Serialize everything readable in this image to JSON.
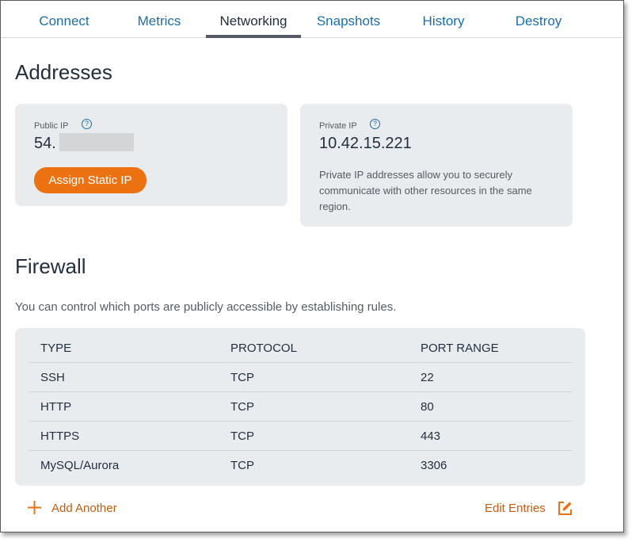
{
  "tabs": [
    {
      "label": "Connect"
    },
    {
      "label": "Metrics"
    },
    {
      "label": "Networking"
    },
    {
      "label": "Snapshots"
    },
    {
      "label": "History"
    },
    {
      "label": "Destroy"
    }
  ],
  "addresses": {
    "title": "Addresses",
    "public": {
      "label": "Public IP",
      "help": "?",
      "value_prefix": "54.",
      "assign_button": "Assign Static IP"
    },
    "private": {
      "label": "Private IP",
      "help": "?",
      "value": "10.42.15.221",
      "description_lines": [
        "Private IP addresses allow you to securely",
        "communicate with other resources in the same",
        "region."
      ]
    }
  },
  "firewall": {
    "title": "Firewall",
    "intro": "You can control which ports are publicly accessible by establishing rules.",
    "columns": [
      "TYPE",
      "PROTOCOL",
      "PORT RANGE"
    ],
    "rows": [
      [
        "SSH",
        "TCP",
        "22"
      ],
      [
        "HTTP",
        "TCP",
        "80"
      ],
      [
        "HTTPS",
        "TCP",
        "443"
      ],
      [
        "MySQL/Aurora",
        "TCP",
        "3306"
      ]
    ],
    "add_label": "Add Another",
    "edit_label": "Edit Entries"
  },
  "colors": {
    "accent_orange": "#ec7211",
    "link_blue": "#1a6ea8",
    "card_bg": "#e9ecee"
  }
}
